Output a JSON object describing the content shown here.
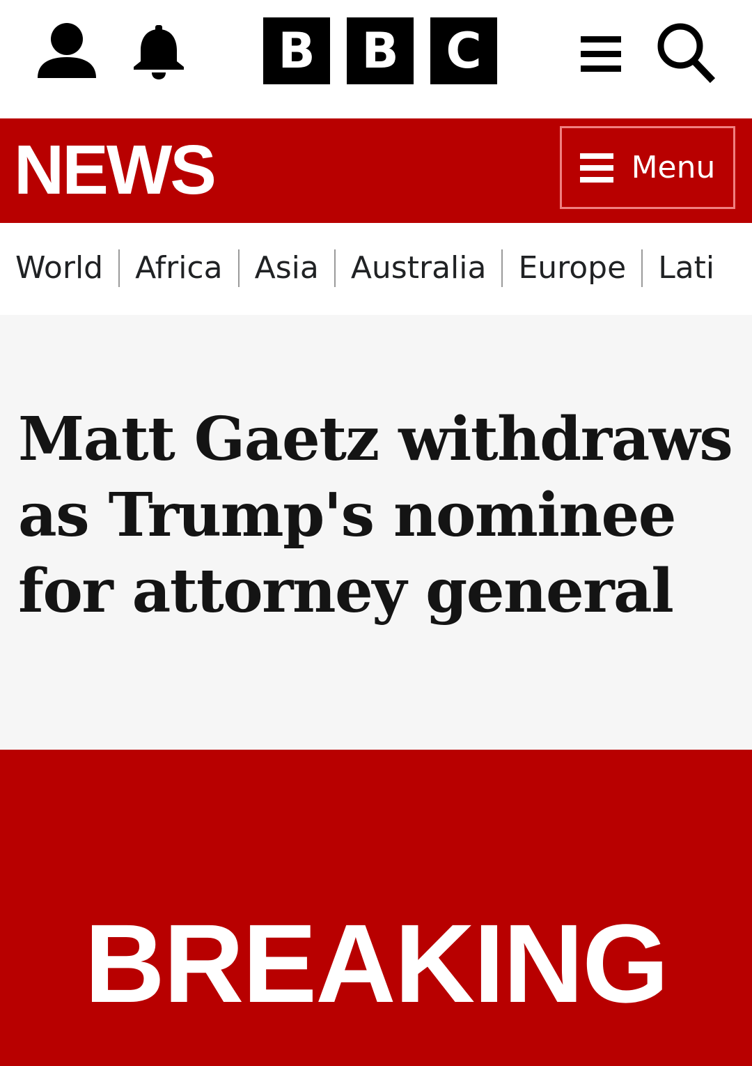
{
  "header": {
    "brand_letters": [
      "B",
      "B",
      "C"
    ],
    "icons": {
      "account": "account-icon",
      "notifications": "bell-icon",
      "more_menu": "hamburger-icon",
      "search": "search-icon"
    }
  },
  "news_bar": {
    "title": "NEWS",
    "menu_label": "Menu",
    "menu_icon": "hamburger-icon"
  },
  "region_nav": {
    "items": [
      "World",
      "Africa",
      "Asia",
      "Australia",
      "Europe",
      "Lati"
    ]
  },
  "article": {
    "headline": "Matt Gaetz withdraws as Trump's nominee for attorney general"
  },
  "banner": {
    "label": "BREAKING"
  },
  "colors": {
    "brand_red": "#b80000",
    "headline_bg": "#f6f6f6",
    "logo_black": "#000000",
    "menu_border": "#f08080",
    "text_dark": "#141414"
  }
}
